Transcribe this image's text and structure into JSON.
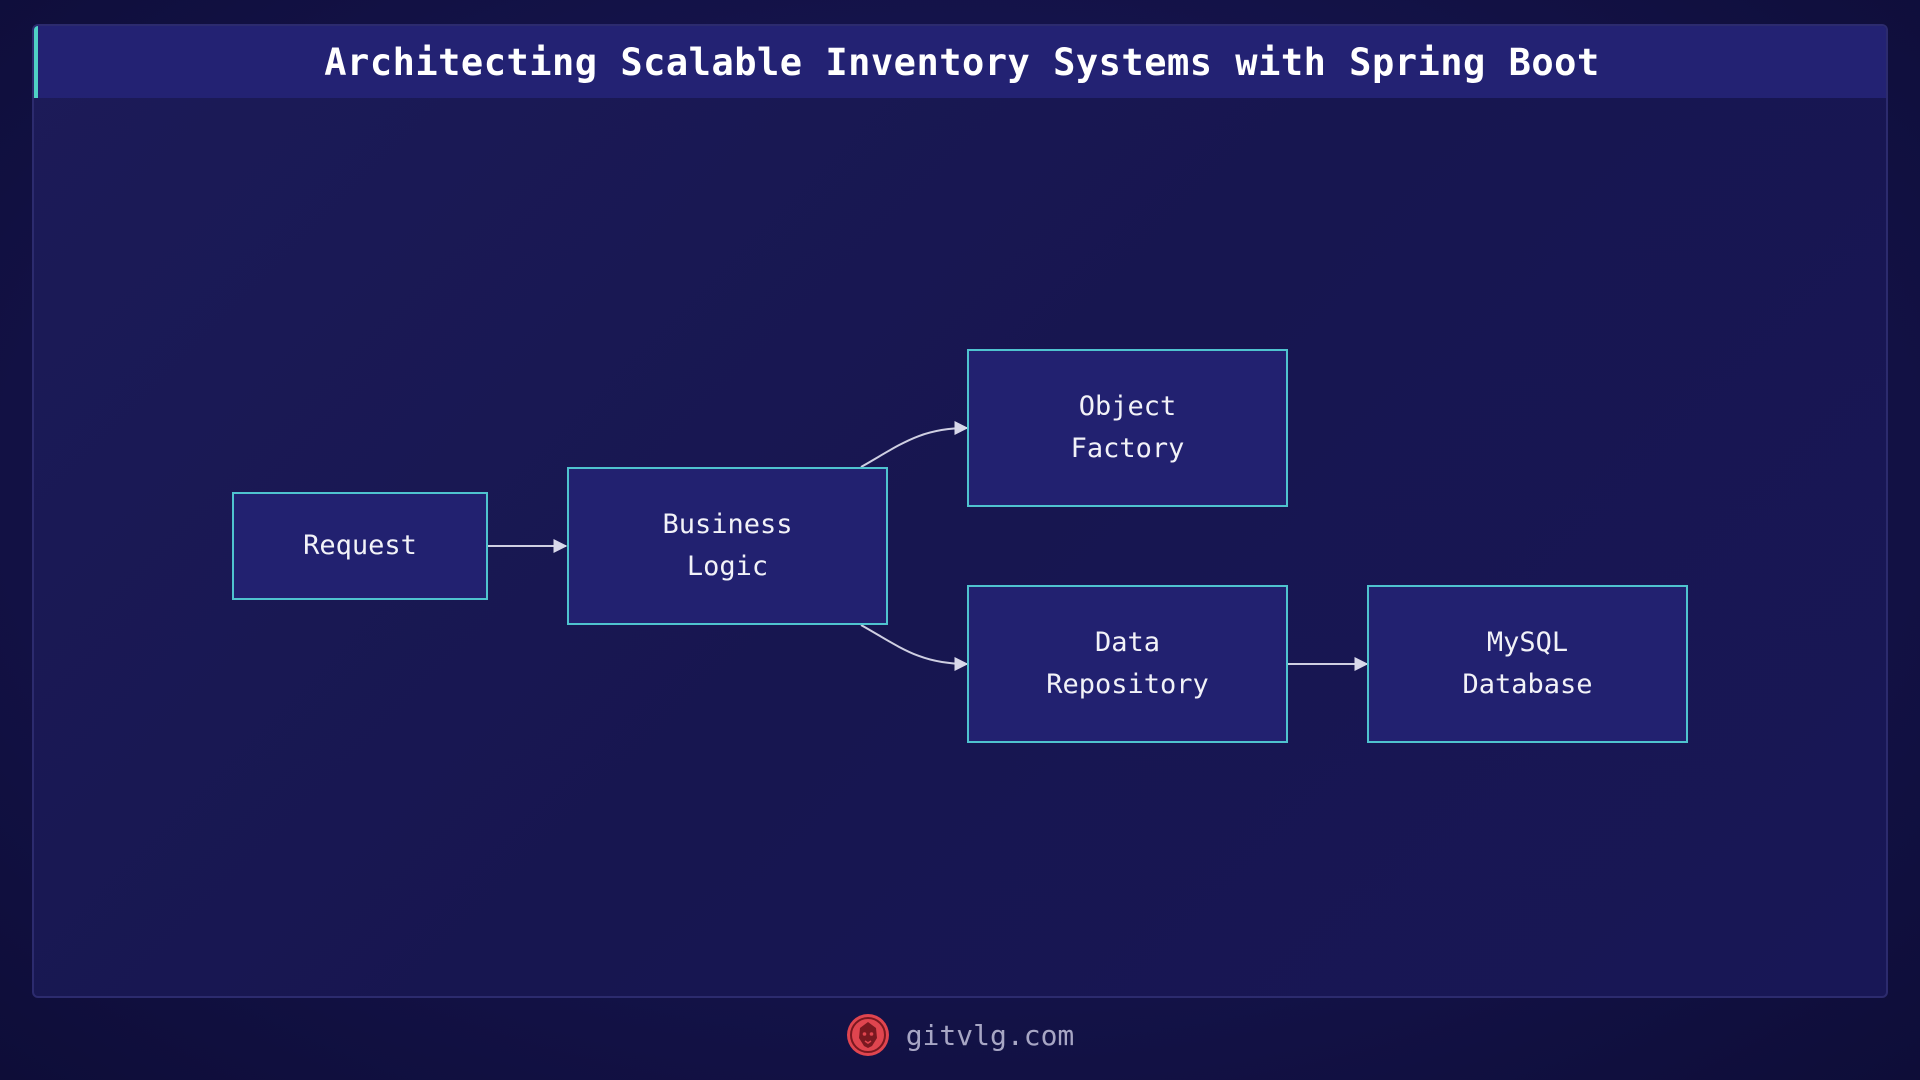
{
  "header": {
    "title": "Architecting Scalable Inventory Systems with Spring Boot"
  },
  "diagram": {
    "nodes": {
      "request": {
        "label": "Request"
      },
      "business_logic": {
        "label": "Business\nLogic"
      },
      "object_factory": {
        "label": "Object\nFactory"
      },
      "data_repository": {
        "label": "Data\nRepository"
      },
      "mysql_database": {
        "label": "MySQL\nDatabase"
      }
    },
    "edges": [
      {
        "from": "request",
        "to": "business_logic"
      },
      {
        "from": "business_logic",
        "to": "object_factory"
      },
      {
        "from": "business_logic",
        "to": "data_repository"
      },
      {
        "from": "data_repository",
        "to": "mysql_database"
      }
    ]
  },
  "footer": {
    "site": "gitvlg.com",
    "logo_icon": "lion-logo-icon"
  },
  "colors": {
    "node_border": "#4fc3cf",
    "node_fill": "#222170",
    "accent": "#4fd1c5",
    "logo": "#e0454f"
  }
}
